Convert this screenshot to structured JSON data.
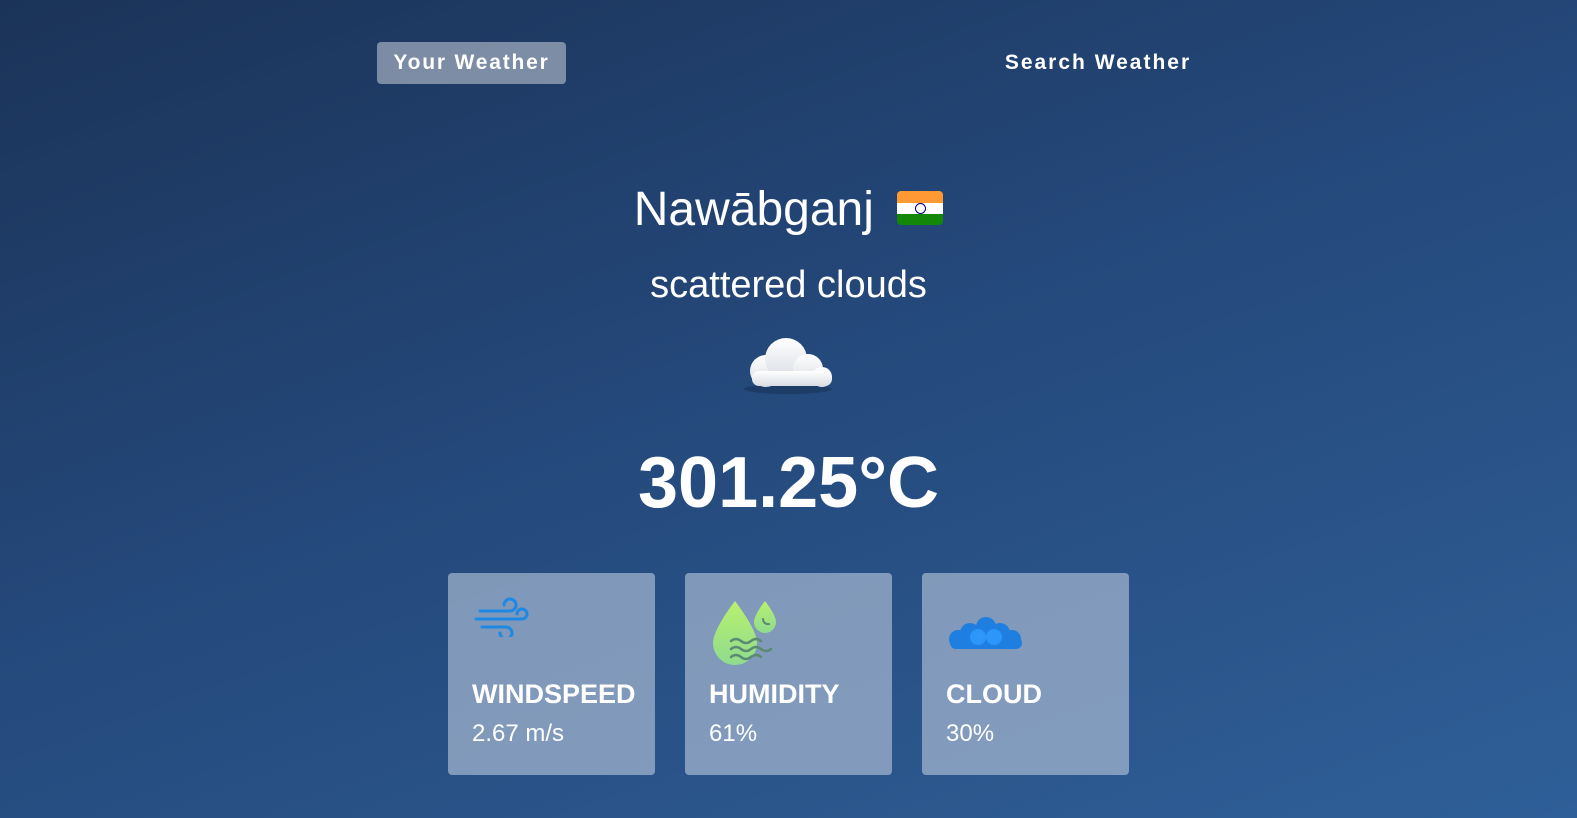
{
  "nav": {
    "your_weather_label": "Your Weather",
    "search_weather_label": "Search Weather"
  },
  "weather": {
    "city": "Nawābganj",
    "country_flag": "india-flag-icon",
    "description": "scattered clouds",
    "condition_icon": "cloud-icon",
    "temperature": "301.25°C"
  },
  "stats": {
    "windspeed": {
      "label": "WINDSPEED",
      "value": "2.67 m/s",
      "icon": "wind-icon"
    },
    "humidity": {
      "label": "HUMIDITY",
      "value": "61%",
      "icon": "humidity-drops-icon"
    },
    "cloud": {
      "label": "CLOUD",
      "value": "30%",
      "icon": "clouds-icon"
    }
  },
  "colors": {
    "background_top": "#1b3358",
    "background_bottom": "#2f5f98",
    "card_bg": "#b8c6dc",
    "wind_icon": "#1e88e5",
    "humidity_icon": "#9be36b",
    "cloud_icon": "#1e7fe0"
  }
}
